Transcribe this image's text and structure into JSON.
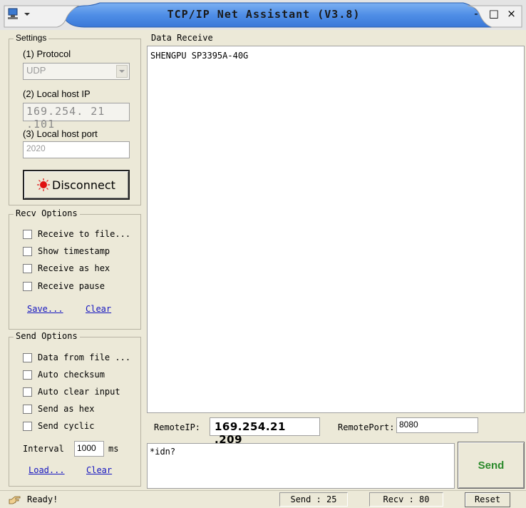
{
  "window": {
    "title": "TCP/IP Net Assistant (V3.8)",
    "controls": {
      "minimize": "-",
      "maximize": "□",
      "close": "×"
    }
  },
  "settings": {
    "group_title": "Settings",
    "protocol_label": "(1) Protocol",
    "protocol_value": "UDP",
    "local_ip_label": "(2) Local host IP",
    "local_ip_value": "169.254. 21 .101",
    "local_port_label": "(3) Local host port",
    "local_port_value": "2020",
    "disconnect_label": "Disconnect"
  },
  "recv_options": {
    "group_title": "Recv Options",
    "items": [
      "Receive to file...",
      "Show timestamp",
      "Receive as hex",
      "Receive pause"
    ],
    "save_link": "Save...",
    "clear_link": "Clear"
  },
  "send_options": {
    "group_title": "Send Options",
    "items": [
      "Data from file ...",
      "Auto checksum",
      "Auto clear input",
      "Send as hex",
      "Send cyclic"
    ],
    "interval_label": "Interval",
    "interval_value": "1000",
    "interval_unit": "ms",
    "load_link": "Load...",
    "clear_link": "Clear"
  },
  "receive": {
    "title": "Data Receive",
    "content": "SHENGPU SP3395A-40G"
  },
  "remote": {
    "ip_label": "RemoteIP:",
    "ip_value": "169.254.21 .209",
    "port_label": "RemotePort:",
    "port_value": "8080"
  },
  "send": {
    "content": "*idn?",
    "button_label": "Send"
  },
  "status": {
    "ready": "Ready!",
    "send_count": "Send : 25",
    "recv_count": "Recv : 80",
    "reset_label": "Reset"
  },
  "colors": {
    "panel": "#ece9d8",
    "link": "#1515c0",
    "send_button_text": "#2a8a2a",
    "led": "#e01010"
  },
  "icons": {
    "system_menu": "network-icon",
    "led": "led-indicator-icon",
    "status": "hand-pointer-icon"
  }
}
